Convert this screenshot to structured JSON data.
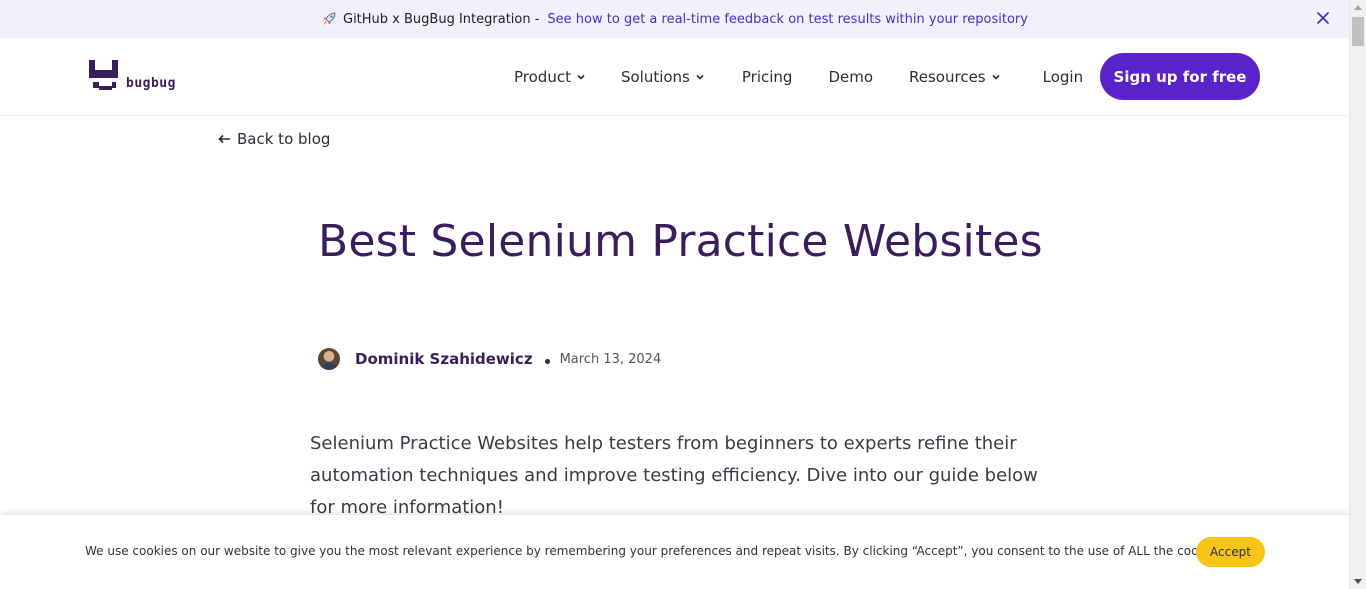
{
  "announcement": {
    "lead": "GitHub x BugBug Integration -",
    "link": "See how to get a real-time feedback on test results within your repository",
    "icon": "rocket-icon",
    "close_icon": "close-icon"
  },
  "header": {
    "logo_text": "bugbug",
    "nav": [
      {
        "label": "Product",
        "dropdown": true
      },
      {
        "label": "Solutions",
        "dropdown": true
      },
      {
        "label": "Pricing",
        "dropdown": false
      },
      {
        "label": "Demo",
        "dropdown": false
      },
      {
        "label": "Resources",
        "dropdown": true
      }
    ],
    "login": "Login",
    "signup": "Sign up for free"
  },
  "article": {
    "back_label": "Back to blog",
    "title": "Best Selenium Practice Websites",
    "author": "Dominik Szahidewicz",
    "date": "March 13, 2024",
    "intro": "Selenium Practice Websites help testers from beginners to experts refine their automation techniques and improve testing efficiency. Dive into our guide below for more information!"
  },
  "cookie": {
    "text": "We use cookies on our website to give you the most relevant experience by remembering your preferences and repeat visits. By clicking “Accept”, you consent to the use of ALL the cookies.",
    "accept": "Accept"
  },
  "colors": {
    "brand": "#3a1d5c",
    "primary": "#5a22c9",
    "link": "#4b2fc7",
    "accept": "#f6c518",
    "announce_bg": "#f2f0fb"
  }
}
